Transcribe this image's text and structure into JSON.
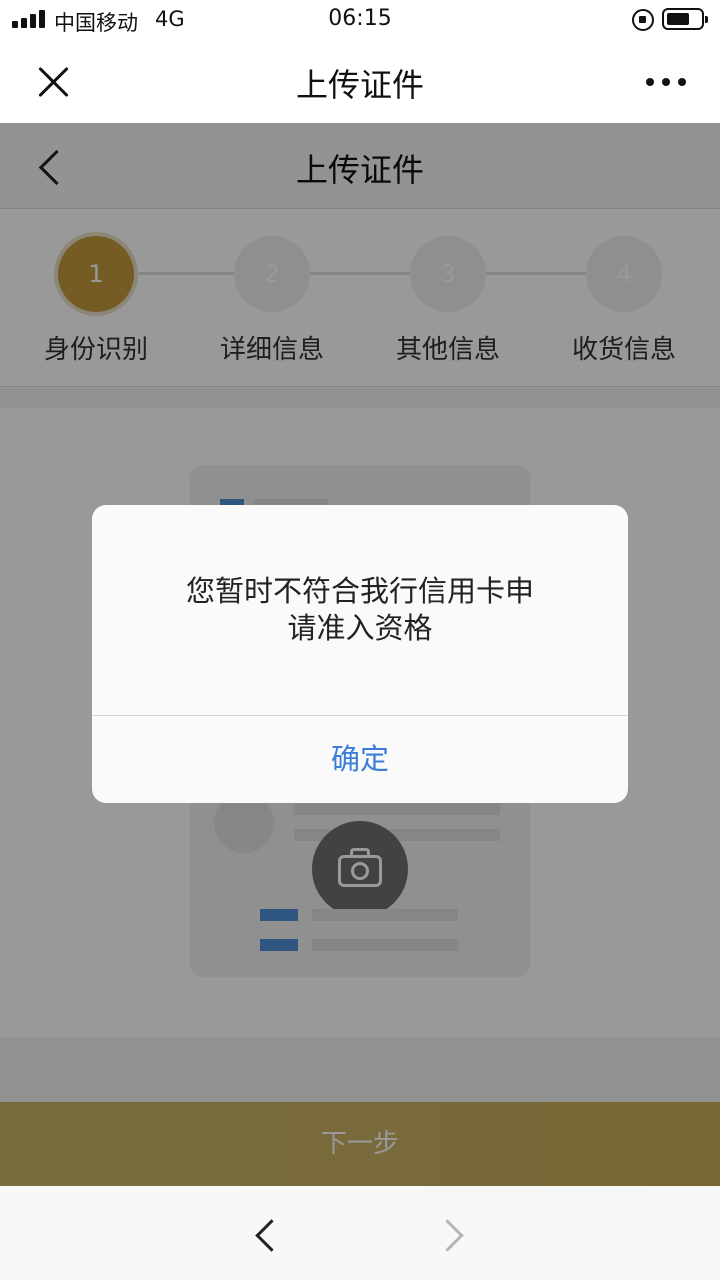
{
  "status_bar": {
    "carrier": "中国移动",
    "network": "4G",
    "time": "06:15",
    "icons": [
      "signal-icon",
      "rotation-lock-icon",
      "battery-icon"
    ]
  },
  "nav_bar": {
    "title": "上传证件",
    "icons": [
      "close-icon",
      "more-icon"
    ]
  },
  "page": {
    "header_title": "上传证件",
    "steps": [
      {
        "number": "1",
        "label": "身份识别",
        "active": true
      },
      {
        "number": "2",
        "label": "详细信息",
        "active": false
      },
      {
        "number": "3",
        "label": "其他信息",
        "active": false
      },
      {
        "number": "4",
        "label": "收货信息",
        "active": false
      }
    ],
    "next_button": "下一步",
    "colors": {
      "accent": "#c39a3c",
      "link": "#3b7dd8",
      "id_bar": "#4f8fd8"
    }
  },
  "dialog": {
    "message_line1": "您暂时不符合我行信用卡申",
    "message_line2": "请准入资格",
    "ok_label": "确定"
  },
  "browser_bar": {
    "icons": [
      "back-icon",
      "forward-icon"
    ]
  }
}
